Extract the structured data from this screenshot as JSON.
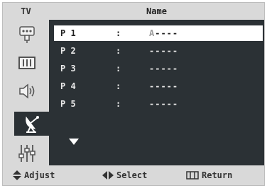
{
  "header": {
    "mode": "TV",
    "title": "Name"
  },
  "sidebar": {
    "items": [
      {
        "icon": "input-icon"
      },
      {
        "icon": "picture-icon"
      },
      {
        "icon": "sound-icon"
      },
      {
        "icon": "channel-icon",
        "active": true
      },
      {
        "icon": "setup-icon"
      }
    ]
  },
  "rows": [
    {
      "label": "P 1",
      "sep": ":",
      "value_first": "A",
      "value_rest": "----",
      "selected": true
    },
    {
      "label": "P 2",
      "sep": ":",
      "value_first": "",
      "value_rest": "-----"
    },
    {
      "label": "P 3",
      "sep": ":",
      "value_first": "",
      "value_rest": "-----"
    },
    {
      "label": "P 4",
      "sep": ":",
      "value_first": "",
      "value_rest": "-----"
    },
    {
      "label": "P 5",
      "sep": ":",
      "value_first": "",
      "value_rest": "-----"
    }
  ],
  "footer": {
    "adjust": "Adjust",
    "select": "Select",
    "return": "Return"
  },
  "colors": {
    "panel": "#2b3135",
    "chrome": "#d9d9d9",
    "highlight": "#ffffff"
  }
}
